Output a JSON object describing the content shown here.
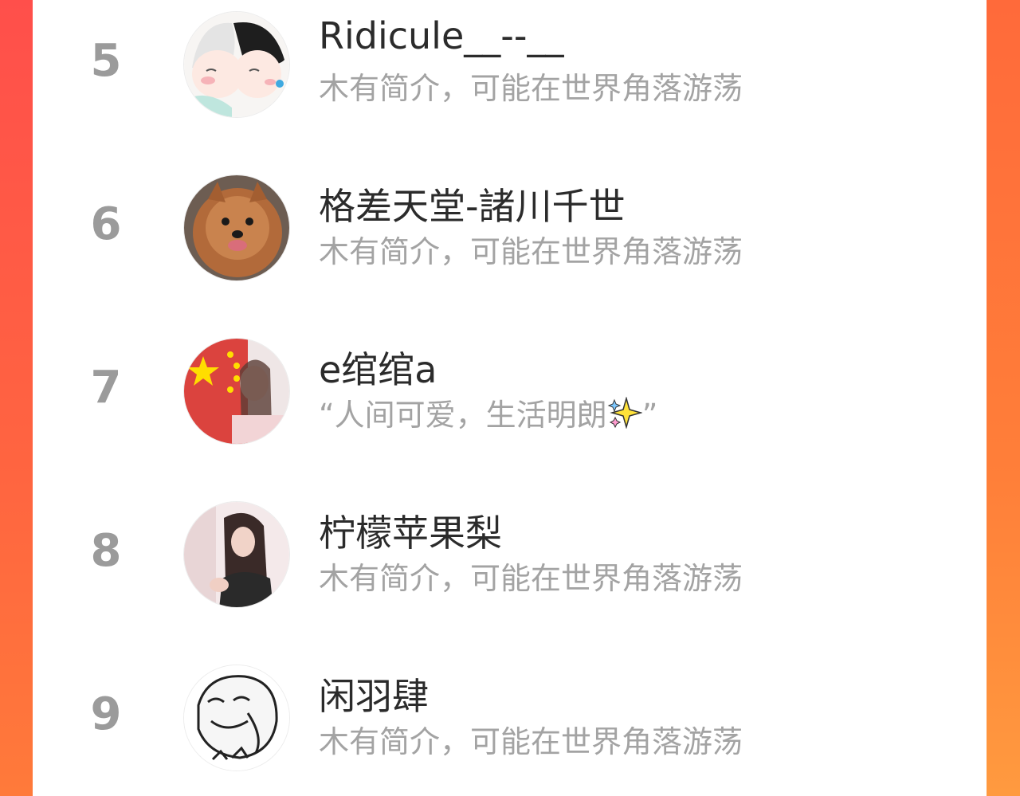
{
  "list": {
    "rows": [
      {
        "rank": "5",
        "name": "Ridicule__--__",
        "bio": "木有简介，可能在世界角落游荡",
        "avatar": "anime-couple-avatar"
      },
      {
        "rank": "6",
        "name": "格差天堂-諸川千世",
        "bio": "木有简介，可能在世界角落游荡",
        "avatar": "pomeranian-dog-avatar"
      },
      {
        "rank": "7",
        "name": "e绾绾a",
        "bio": "“人间可爱，生活明朗",
        "bio_suffix": "”",
        "avatar": "flag-girl-avatar",
        "bio_icon": "sparkles-icon"
      },
      {
        "rank": "8",
        "name": "柠檬苹果梨",
        "bio": "木有简介，可能在世界角落游荡",
        "avatar": "girl-photo-avatar"
      },
      {
        "rank": "9",
        "name": "闲羽肆",
        "bio": "木有简介，可能在世界角落游荡",
        "avatar": "meme-face-avatar"
      }
    ]
  },
  "colors": {
    "accent_gradient_start": "#ff5446",
    "accent_gradient_end": "#ff8a3a",
    "rank_color": "#9b9b9b",
    "name_color": "#2b2b2b",
    "bio_color": "#a3a3a3"
  }
}
